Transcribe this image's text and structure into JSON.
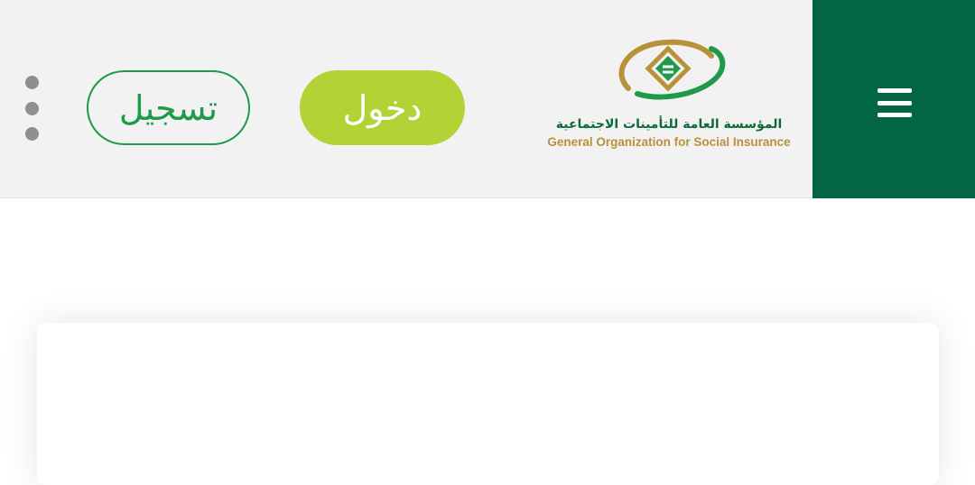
{
  "header": {
    "register_label": "تسجيل",
    "login_label": "دخول",
    "logo": {
      "arabic_name": "المؤسسة العامة للتأمينات الاجتماعية",
      "english_name": "General Organization for Social Insurance"
    },
    "menu_icon": "hamburger-icon",
    "more_icon": "more-vertical-icon"
  },
  "colors": {
    "brand_green": "#036642",
    "login_bg": "#b2d235",
    "register_border": "#1f9a4a",
    "header_bg": "#f2f2f2",
    "logo_gold": "#b8923a"
  }
}
